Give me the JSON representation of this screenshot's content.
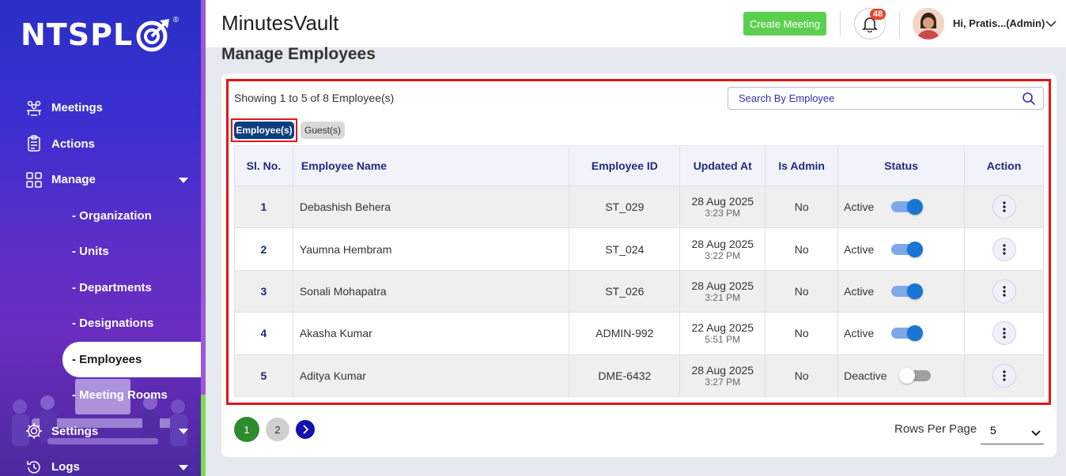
{
  "brand": {
    "logo_text": "NTSPL",
    "registered": "®"
  },
  "sidebar": {
    "items": [
      {
        "label": "Meetings",
        "icon": "meetings-icon"
      },
      {
        "label": "Actions",
        "icon": "clipboard-icon"
      },
      {
        "label": "Manage",
        "icon": "grid-icon"
      }
    ],
    "sub_items": [
      {
        "label": "- Organization"
      },
      {
        "label": "- Units"
      },
      {
        "label": "- Departments"
      },
      {
        "label": "- Designations"
      },
      {
        "label": "- Employees",
        "active": true
      },
      {
        "label": "- Meeting Rooms"
      }
    ],
    "bottom_items": [
      {
        "label": "Settings",
        "icon": "gear-icon"
      },
      {
        "label": "Logs",
        "icon": "history-icon"
      }
    ]
  },
  "header": {
    "app_title": "MinutesVault",
    "create_button": "Create Meeting",
    "notification_count": "48",
    "user_name": "Hi, Pratis...(Admin)"
  },
  "page": {
    "title": "Manage Employees"
  },
  "list": {
    "showing_text": "Showing 1 to 5 of 8 Employee(s)",
    "search_placeholder": "Search By Employee",
    "tabs": {
      "employees": "Employee(s)",
      "guests": "Guest(s)"
    },
    "columns": [
      "Sl. No.",
      "Employee Name",
      "Employee ID",
      "Updated At",
      "Is Admin",
      "Status",
      "Action"
    ],
    "rows": [
      {
        "sl": "1",
        "name": "Debashish Behera",
        "emp_id": "ST_029",
        "date": "28 Aug 2025",
        "time": "3:23 PM",
        "is_admin": "No",
        "status": "Active",
        "enabled": true
      },
      {
        "sl": "2",
        "name": "Yaumna Hembram",
        "emp_id": "ST_024",
        "date": "28 Aug 2025",
        "time": "3:22 PM",
        "is_admin": "No",
        "status": "Active",
        "enabled": true
      },
      {
        "sl": "3",
        "name": "Sonali Mohapatra",
        "emp_id": "ST_026",
        "date": "28 Aug 2025",
        "time": "3:21 PM",
        "is_admin": "No",
        "status": "Active",
        "enabled": true
      },
      {
        "sl": "4",
        "name": "Akasha Kumar",
        "emp_id": "ADMIN-992",
        "date": "22 Aug 2025",
        "time": "5:51 PM",
        "is_admin": "No",
        "status": "Active",
        "enabled": true
      },
      {
        "sl": "5",
        "name": "Aditya Kumar",
        "emp_id": "DME-6432",
        "date": "28 Aug 2025",
        "time": "3:27 PM",
        "is_admin": "No",
        "status": "Deactive",
        "enabled": false
      }
    ]
  },
  "pagination": {
    "pages": [
      "1",
      "2"
    ],
    "current": "1",
    "rows_per_page_label": "Rows Per Page",
    "rows_per_page_value": "5"
  },
  "colors": {
    "primary": "#0c3d7e",
    "accent_green": "#5ccf4f",
    "highlight_red": "#e01616",
    "toggle_on": "#1976d2",
    "pager_current": "#2e8b2e"
  }
}
